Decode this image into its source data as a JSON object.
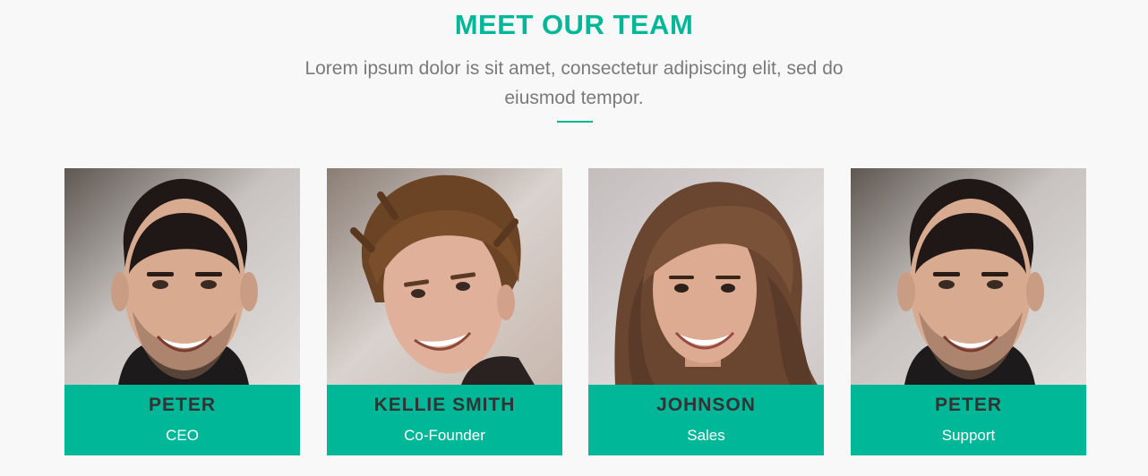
{
  "section": {
    "title": "MEET OUR TEAM",
    "subtitle": "Lorem ipsum dolor is sit amet, consectetur adipiscing elit, sed do eiusmod tempor."
  },
  "team": {
    "members": [
      {
        "name": "PETER",
        "role": "CEO"
      },
      {
        "name": "KELLIE SMITH",
        "role": "Co-Founder"
      },
      {
        "name": "JOHNSON",
        "role": "Sales"
      },
      {
        "name": "PETER",
        "role": "Support"
      }
    ]
  },
  "colors": {
    "accent": "#00b798",
    "background": "#f8f8f8",
    "name_text": "#333333",
    "role_text": "#ffffff",
    "subtitle_text": "#7a7a7a"
  }
}
